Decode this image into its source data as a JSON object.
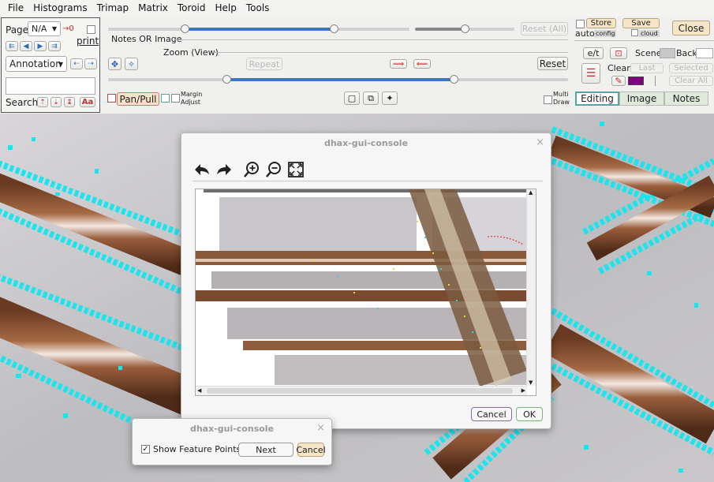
{
  "menu": [
    "File",
    "Histograms",
    "Trimap",
    "Matrix",
    "Toroid",
    "Help",
    "Tools"
  ],
  "left": {
    "page_label": "Page",
    "page_value": "N/A",
    "page_arrow": "→0",
    "print_label": "print",
    "annotation_value": "Annotation",
    "search_label": "Search",
    "search_value": "",
    "aa_label": "Aa"
  },
  "toolbar": {
    "notes_label": "Notes OR Image",
    "zoom_label": "Zoom (View)",
    "repeat_label": "Repeat",
    "reset_label": "Reset",
    "reset_all_label": "Reset (All)",
    "panpull_label": "Pan/Pull",
    "margin_label": "Margin",
    "adjust_label": "Adjust",
    "multi_label": "Multi",
    "draw_label": "Draw"
  },
  "right": {
    "auto_label": "auto",
    "store_label": "Store",
    "config_label": "config",
    "save_label": "Save",
    "cloud_label": "cloud",
    "close_label": "Close",
    "et_label": "e/t",
    "scene_label": "Scene",
    "back_label": "Back",
    "clear_label": "Clear:",
    "last_label": "Last",
    "selected_label": "Selected",
    "clear_all_label": "Clear All"
  },
  "tabs": [
    "Editing",
    "Image",
    "Notes"
  ],
  "colors": {
    "accent": "#3c77bd",
    "cyan": "#19e5ee",
    "purple": "#800080",
    "red_arrow": "#cc2222"
  },
  "dialog_main": {
    "title": "dhax-gui-console",
    "cancel_label": "Cancel",
    "ok_label": "OK",
    "icons": [
      "undo-arrow-icon",
      "redo-arrow-icon",
      "zoom-in-icon",
      "zoom-out-icon",
      "fit-screen-icon"
    ]
  },
  "dialog_small": {
    "title": "dhax-gui-console",
    "show_features_label": "Show Feature Points",
    "show_features_checked": true,
    "next_label": "Next",
    "cancel_label": "Cancel"
  }
}
